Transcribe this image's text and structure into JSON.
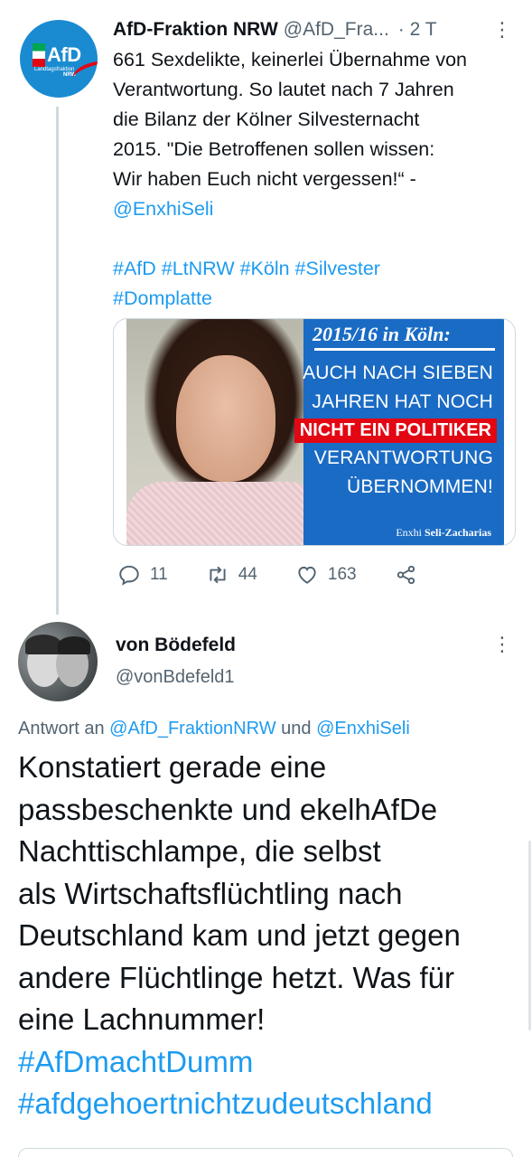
{
  "parent_tweet": {
    "author_name": "AfD-Fraktion NRW",
    "author_handle": "@AfD_Fra...",
    "time": "· 2 T",
    "more": "⋮",
    "avatar": {
      "logo_text": "AfD",
      "subtitle": "Landtagsfraktion",
      "region": "NRW"
    },
    "text_lines": [
      "661 Sexdelikte, keinerlei Übernahme von",
      "Verantwortung. So lautet nach 7 Jahren",
      "die Bilanz der Kölner Silvesternacht",
      "2015. \"Die Betroffenen sollen wissen:",
      "Wir haben Euch nicht vergessen!“ -"
    ],
    "mention": "@EnxhiSeli",
    "hashtags_line1": "#AfD #LtNRW #Köln #Silvester",
    "hashtags_line2": "#Domplatte",
    "media": {
      "title": "2015/16 in Köln:",
      "line1": "AUCH NACH SIEBEN",
      "line2": "JAHREN HAT NOCH",
      "highlight": "NICHT EIN POLITIKER",
      "line3": "VERANTWORTUNG",
      "line4": "ÜBERNOMMEN!",
      "signature_first": "Enxhi",
      "signature_last": "Seli-Zacharias"
    },
    "actions": {
      "replies": "11",
      "retweets": "44",
      "likes": "163"
    }
  },
  "reply_tweet": {
    "author_name": "von Bödefeld",
    "author_handle": "@vonBdefeld1",
    "more": "⋮",
    "replying_prefix": "Antwort an",
    "replying_to_1": "@AfD_FraktionNRW",
    "replying_and": "und",
    "replying_to_2": "@EnxhiSeli",
    "text_lines": [
      "Konstatiert gerade eine",
      "passbeschenkte und ekelhAfDe",
      "Nachttischlampe, die selbst",
      "als Wirtschaftsflüchtling nach",
      "Deutschland kam und jetzt gegen",
      "andere Flüchtlinge hetzt. Was für",
      "eine Lachnummer!"
    ],
    "hashtag1": "#AfDmachtDumm",
    "hashtag2": "#afdgehoertnichtzudeutschland"
  },
  "colors": {
    "link": "#1d9bf0",
    "secondary_text": "#536471",
    "banner_blue": "#1a6bc4",
    "banner_red": "#e30613"
  }
}
